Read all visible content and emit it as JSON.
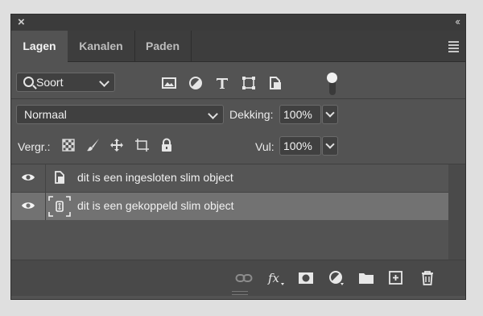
{
  "window": {
    "close_glyph": "×",
    "collapse_glyph": "‹‹"
  },
  "tabs": [
    {
      "label": "Lagen",
      "active": true
    },
    {
      "label": "Kanalen",
      "active": false
    },
    {
      "label": "Paden",
      "active": false
    }
  ],
  "filter": {
    "kind_label": "Soort",
    "icons": [
      "image-filter-icon",
      "adjustment-filter-icon",
      "type-filter-icon",
      "shape-filter-icon",
      "smart-object-filter-icon"
    ],
    "toggle_on": true
  },
  "blend": {
    "mode": "Normaal",
    "opacity_label": "Dekking:",
    "opacity_value": "100%"
  },
  "locks": {
    "label": "Vergr.:",
    "icons": [
      "lock-transparent-pixels-icon",
      "lock-image-pixels-icon",
      "lock-position-icon",
      "lock-artboard-icon",
      "lock-all-icon"
    ],
    "fill_label": "Vul:",
    "fill_value": "100%"
  },
  "layers": [
    {
      "name": "dit is een ingesloten slim object",
      "visible": true,
      "type": "embedded-smart-object",
      "selected": false
    },
    {
      "name": "dit is een gekoppeld slim object",
      "visible": true,
      "type": "linked-smart-object",
      "selected": true
    }
  ],
  "bottom_toolbar": [
    "link-layers-icon",
    "fx-icon",
    "layer-mask-icon",
    "adjustment-layer-icon",
    "group-folder-icon",
    "new-layer-icon",
    "trash-icon"
  ],
  "colors": {
    "panel": "#535353",
    "selected_row": "#727272",
    "tab_bar": "#3d3d3d"
  }
}
